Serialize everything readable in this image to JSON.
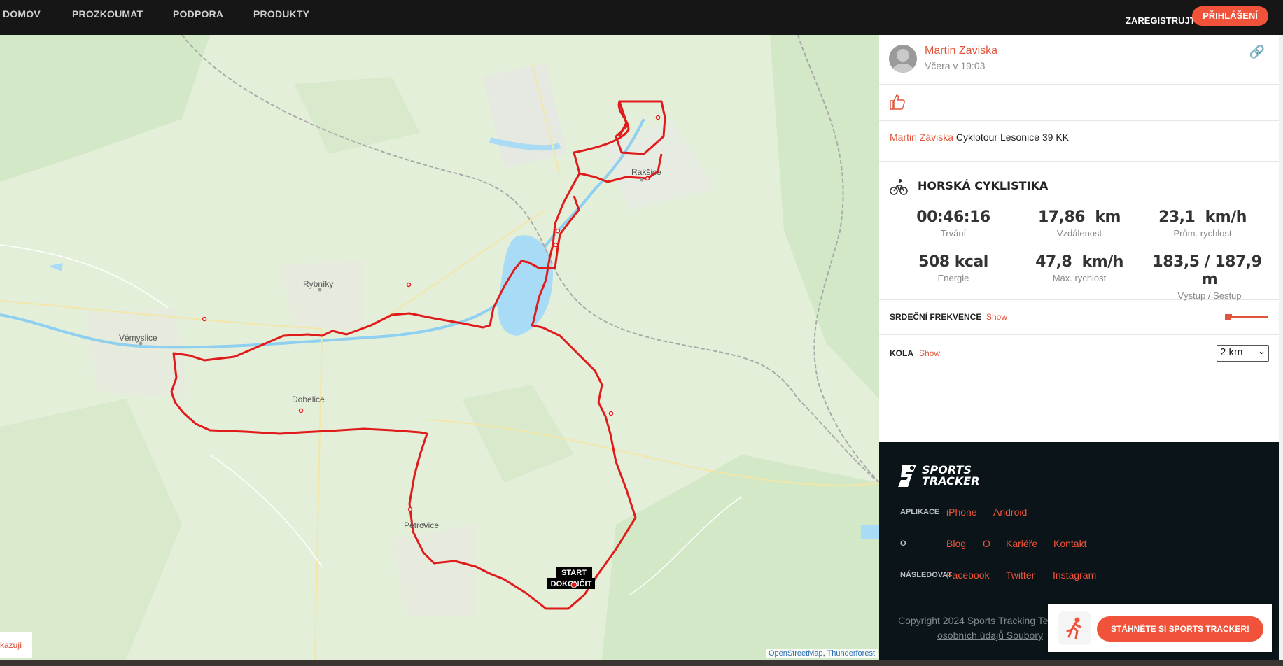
{
  "nav": {
    "items": [
      "DOMOV",
      "PROZKOUMAT",
      "PODPORA",
      "PRODUKTY"
    ],
    "register": "ZAREGISTRUJTE SE",
    "login": "PŘIHLÁŠENÍ"
  },
  "map": {
    "places": {
      "rybniky": "Rybníky",
      "vemyslice": "Vémyslice",
      "dobelice": "Dobelice",
      "petrovice": "Petrovice",
      "rakslice": "Rakšice"
    },
    "start_label": "START",
    "finish_label": "DOKONČIT",
    "attribution": {
      "osm": "OpenStreetMap",
      "thunderforest": "Thunderforest",
      "separator": ","
    },
    "legend_text": "kazují",
    "route_color": "#e01b1b"
  },
  "workout": {
    "user_name": "Martin Zaviska",
    "time": "Včera v 19:03",
    "description_user": "Martin Záviska",
    "description_text": "Cyklotour Lesonice 39 KK",
    "sport": "HORSKÁ CYKLISTIKA",
    "stats": [
      {
        "value": "00:46:16",
        "unit": "",
        "label": "Trvání"
      },
      {
        "value": "17,86",
        "unit": "km",
        "label": "Vzdálenost"
      },
      {
        "value": "23,1",
        "unit": "km/h",
        "label": "Prům. rychlost"
      },
      {
        "value": "508 kcal",
        "unit": "",
        "label": "Energie"
      },
      {
        "value": "47,8",
        "unit": "km/h",
        "label": "Max. rychlost"
      },
      {
        "value": "183,5 / 187,9",
        "unit": "m",
        "label": "Výstup / Sestup"
      }
    ],
    "heart_rate_label": "SRDEČNÍ FREKVENCE",
    "heart_rate_show": "Show",
    "laps_label": "KOLA",
    "laps_show": "Show",
    "laps_select": "2 km"
  },
  "footer": {
    "brand_line1": "SPORTS",
    "brand_line2": "TRACKER",
    "apps_label": "APLIKACE",
    "apps": [
      "iPhone",
      "Android"
    ],
    "about_label": "O",
    "about_links": [
      "Blog",
      "O",
      "Kariéře",
      "Kontakt"
    ],
    "follow_label": "NÁSLEDOVAT",
    "follow_links": [
      "Facebook",
      "Twitter",
      "Instagram"
    ],
    "copyright": "Copyright 2024 Sports Tracking Te",
    "privacy": "osobních údajů Soubory"
  },
  "promo": {
    "button": "STÁHNĚTE SI SPORTS TRACKER!"
  },
  "colors": {
    "accent": "#f0533a",
    "topbar": "#161616",
    "footer": "#0b1418"
  }
}
